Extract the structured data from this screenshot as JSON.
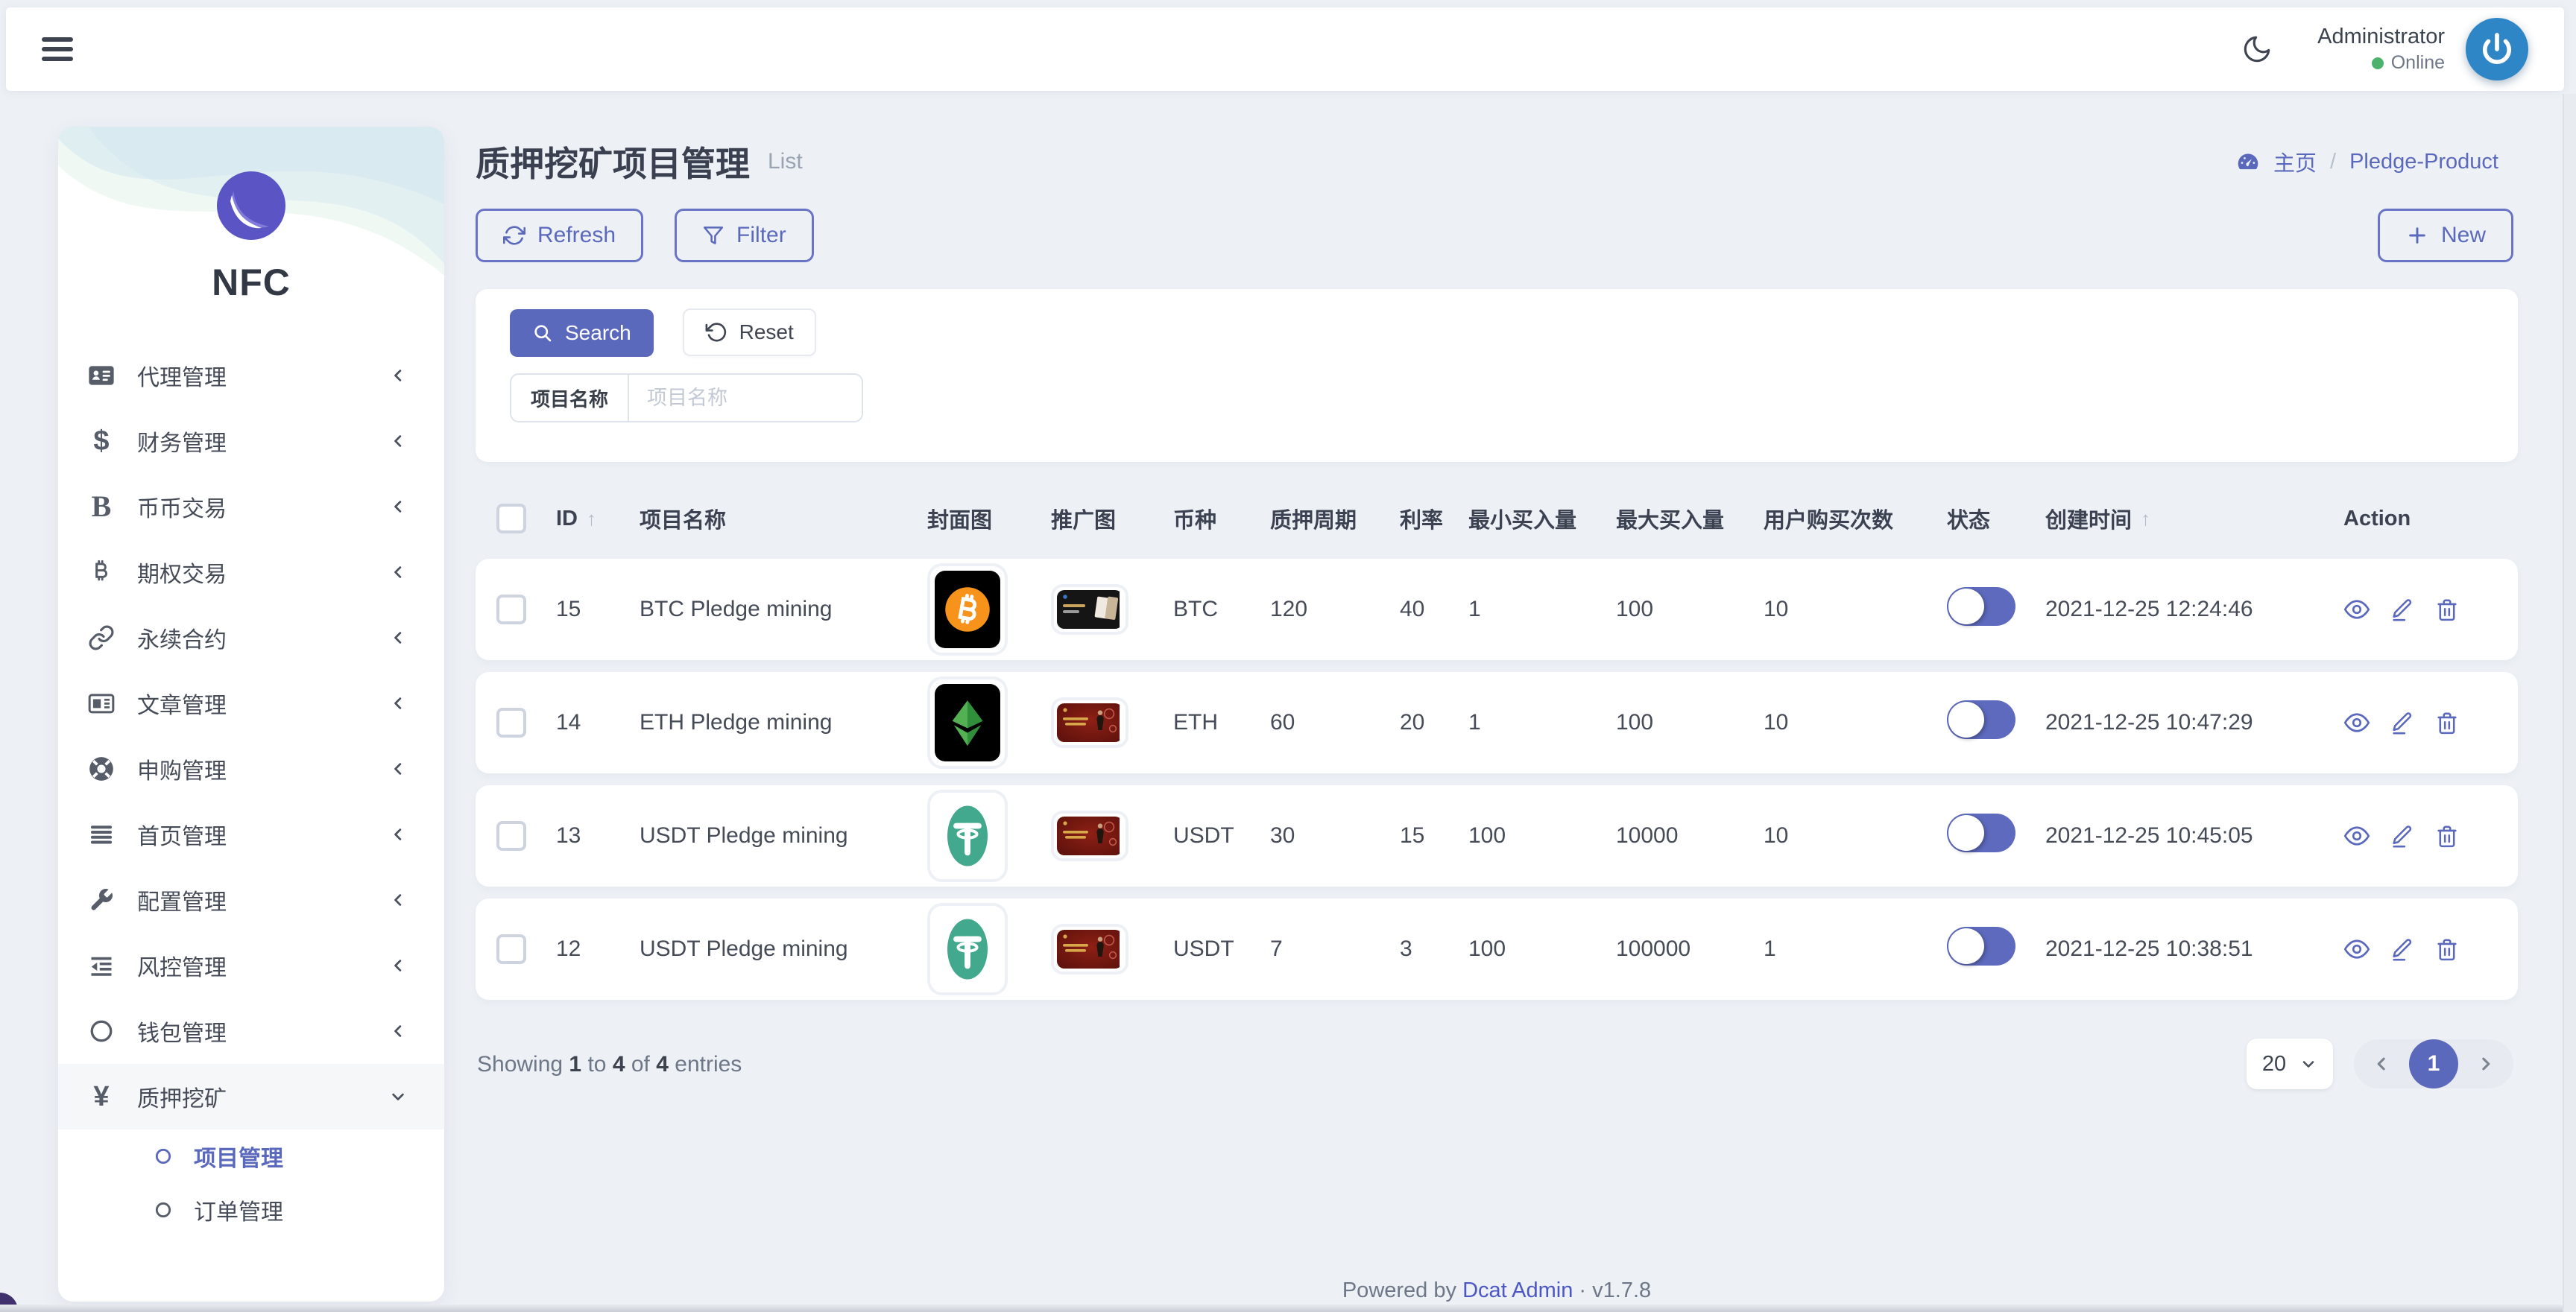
{
  "topbar": {
    "user_name": "Administrator",
    "user_status": "Online"
  },
  "sidebar": {
    "brand": "NFC",
    "items": [
      {
        "label": "代理管理",
        "icon": "id-card"
      },
      {
        "label": "财务管理",
        "icon": "dollar"
      },
      {
        "label": "币币交易",
        "icon": "bold-b"
      },
      {
        "label": "期权交易",
        "icon": "bitcoin"
      },
      {
        "label": "永续合约",
        "icon": "link"
      },
      {
        "label": "文章管理",
        "icon": "newspaper"
      },
      {
        "label": "申购管理",
        "icon": "life-ring"
      },
      {
        "label": "首页管理",
        "icon": "list"
      },
      {
        "label": "配置管理",
        "icon": "wrench"
      },
      {
        "label": "风控管理",
        "icon": "indent"
      },
      {
        "label": "钱包管理",
        "icon": "circle"
      },
      {
        "label": "质押挖矿",
        "icon": "yen",
        "expanded": true
      }
    ],
    "submenu": [
      {
        "label": "项目管理",
        "active": true
      },
      {
        "label": "订单管理",
        "active": false
      }
    ]
  },
  "page": {
    "title": "质押挖矿项目管理",
    "subtitle": "List",
    "breadcrumb": {
      "home": "主页",
      "separator": "/",
      "current": "Pledge-Product"
    }
  },
  "toolbar": {
    "refresh_label": "Refresh",
    "filter_label": "Filter",
    "new_label": "New"
  },
  "search_panel": {
    "search_label": "Search",
    "reset_label": "Reset",
    "field_label": "项目名称",
    "input_placeholder": "项目名称",
    "input_value": ""
  },
  "table": {
    "headers": [
      {
        "label": "ID",
        "sortable": true
      },
      {
        "label": "项目名称"
      },
      {
        "label": "封面图"
      },
      {
        "label": "推广图"
      },
      {
        "label": "币种"
      },
      {
        "label": "质押周期"
      },
      {
        "label": "利率"
      },
      {
        "label": "最小买入量"
      },
      {
        "label": "最大买入量"
      },
      {
        "label": "用户购买次数"
      },
      {
        "label": "状态"
      },
      {
        "label": "创建时间",
        "sortable": true
      },
      {
        "label": "Action"
      }
    ],
    "rows": [
      {
        "id": "15",
        "name": "BTC Pledge mining",
        "cover": "btc",
        "promo": "dark",
        "coin": "BTC",
        "period": "120",
        "rate": "40",
        "min_buy": "1",
        "max_buy": "100",
        "buy_count": "10",
        "status_on": true,
        "created": "2021-12-25 12:24:46"
      },
      {
        "id": "14",
        "name": "ETH Pledge mining",
        "cover": "etc",
        "promo": "red",
        "coin": "ETH",
        "period": "60",
        "rate": "20",
        "min_buy": "1",
        "max_buy": "100",
        "buy_count": "10",
        "status_on": true,
        "created": "2021-12-25 10:47:29"
      },
      {
        "id": "13",
        "name": "USDT Pledge mining",
        "cover": "usdt",
        "promo": "red",
        "coin": "USDT",
        "period": "30",
        "rate": "15",
        "min_buy": "100",
        "max_buy": "10000",
        "buy_count": "10",
        "status_on": true,
        "created": "2021-12-25 10:45:05"
      },
      {
        "id": "12",
        "name": "USDT Pledge mining",
        "cover": "usdt",
        "promo": "red",
        "coin": "USDT",
        "period": "7",
        "rate": "3",
        "min_buy": "100",
        "max_buy": "100000",
        "buy_count": "1",
        "status_on": true,
        "created": "2021-12-25 10:38:51"
      }
    ]
  },
  "pagination": {
    "showing_prefix": "Showing",
    "from": "1",
    "to_word": "to",
    "to": "4",
    "of_word": "of",
    "total": "4",
    "entries_word": "entries",
    "page_size": "20",
    "page": "1"
  },
  "footer": {
    "powered_by": "Powered by",
    "brand": "Dcat Admin",
    "separator": "·",
    "version": "v1.7.8"
  },
  "colors": {
    "accent": "#5b69bc",
    "toggle_on": "#5e6abe",
    "online_green": "#4db36b",
    "avatar_blue": "#2f86c6",
    "btc_orange": "#f7931a",
    "usdt_green": "#43a98e",
    "etc_green": "#53b153",
    "page_bg": "#edf1f6"
  }
}
